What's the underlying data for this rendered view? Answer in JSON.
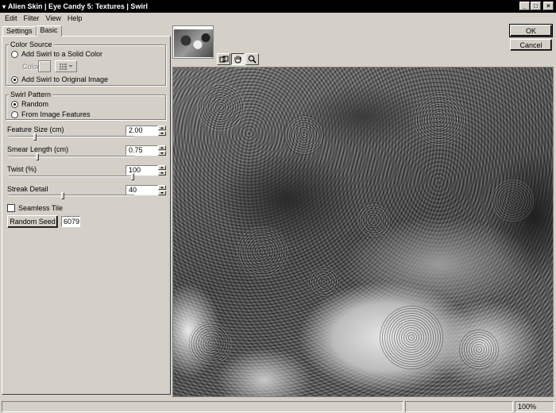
{
  "window": {
    "title": "Alien Skin | Eye Candy 5: Textures | Swirl",
    "buttons": [
      "_",
      "□",
      "×"
    ]
  },
  "menu": [
    "Edit",
    "Filter",
    "View",
    "Help"
  ],
  "tabs": [
    {
      "label": "Settings",
      "active": false
    },
    {
      "label": "Basic",
      "active": true
    }
  ],
  "color_source": {
    "label": "Color Source",
    "option_solid": "Add Swirl to a Solid Color",
    "color_label": "Color",
    "option_original": "Add Swirl to Original Image",
    "selected": "original"
  },
  "swirl_pattern": {
    "label": "Swirl Pattern",
    "option_random": "Random",
    "option_features": "From Image Features",
    "selected": "random"
  },
  "params": [
    {
      "label": "Feature Size (cm)",
      "value": "2.00",
      "fraction": 0.2
    },
    {
      "label": "Smear Length (cm)",
      "value": "0.75",
      "fraction": 0.22
    },
    {
      "label": "Twist (%)",
      "value": "100",
      "fraction": 1.0
    },
    {
      "label": "Streak Detail",
      "value": "40",
      "fraction": 0.43
    }
  ],
  "seamless_tile": {
    "label": "Seamless Tile",
    "checked": false
  },
  "random_seed": {
    "button_label": "Random Seed",
    "value": "6079"
  },
  "actions": {
    "ok": "OK",
    "cancel": "Cancel"
  },
  "status": {
    "zoom": "100%"
  },
  "icons": {
    "compare": "compare-icon",
    "hand": "hand-icon",
    "zoom": "magnifier-icon"
  }
}
